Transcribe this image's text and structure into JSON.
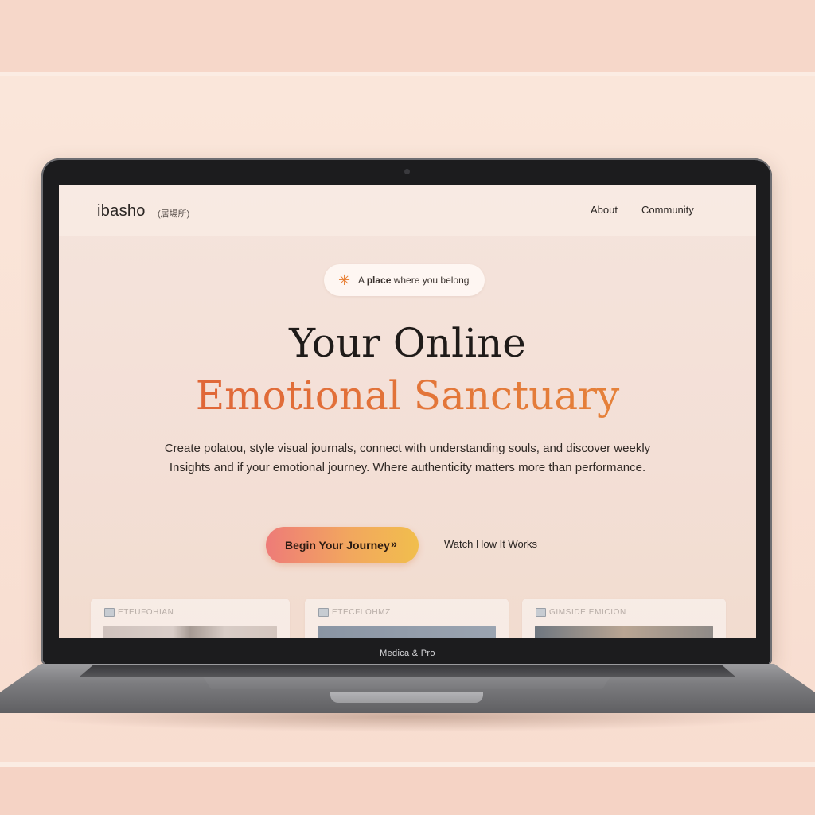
{
  "header": {
    "brand": "ibasho",
    "brand_sub": "(居場所)",
    "nav": [
      "About",
      "Community"
    ]
  },
  "hero": {
    "tag_icon": "sparkle-icon",
    "tag_prefix": "A ",
    "tag_bold": "place",
    "tag_suffix": " where you belong",
    "title_line1": "Your Online",
    "title_line2": "Emotional Sanctuary",
    "description": "Create polatou, style visual journals, connect with understanding souls, and discover weekly Insights and if your emotional journey. Where authenticity matters more than performance.",
    "cta_primary": "Begin Your Journey",
    "cta_primary_icon": "»",
    "cta_secondary": "Watch How It Works"
  },
  "cards": [
    {
      "title": "ETEUFOHIAN"
    },
    {
      "title": "ETECFLOHMZ"
    },
    {
      "title": "GIMSIDE EMICION"
    }
  ],
  "device": {
    "label": "Medica & Pro"
  },
  "colors": {
    "accent": "#e46e34",
    "cta_gradient_start": "#ee7b78",
    "cta_gradient_end": "#f1be4d",
    "background": "#f6d9cb"
  }
}
